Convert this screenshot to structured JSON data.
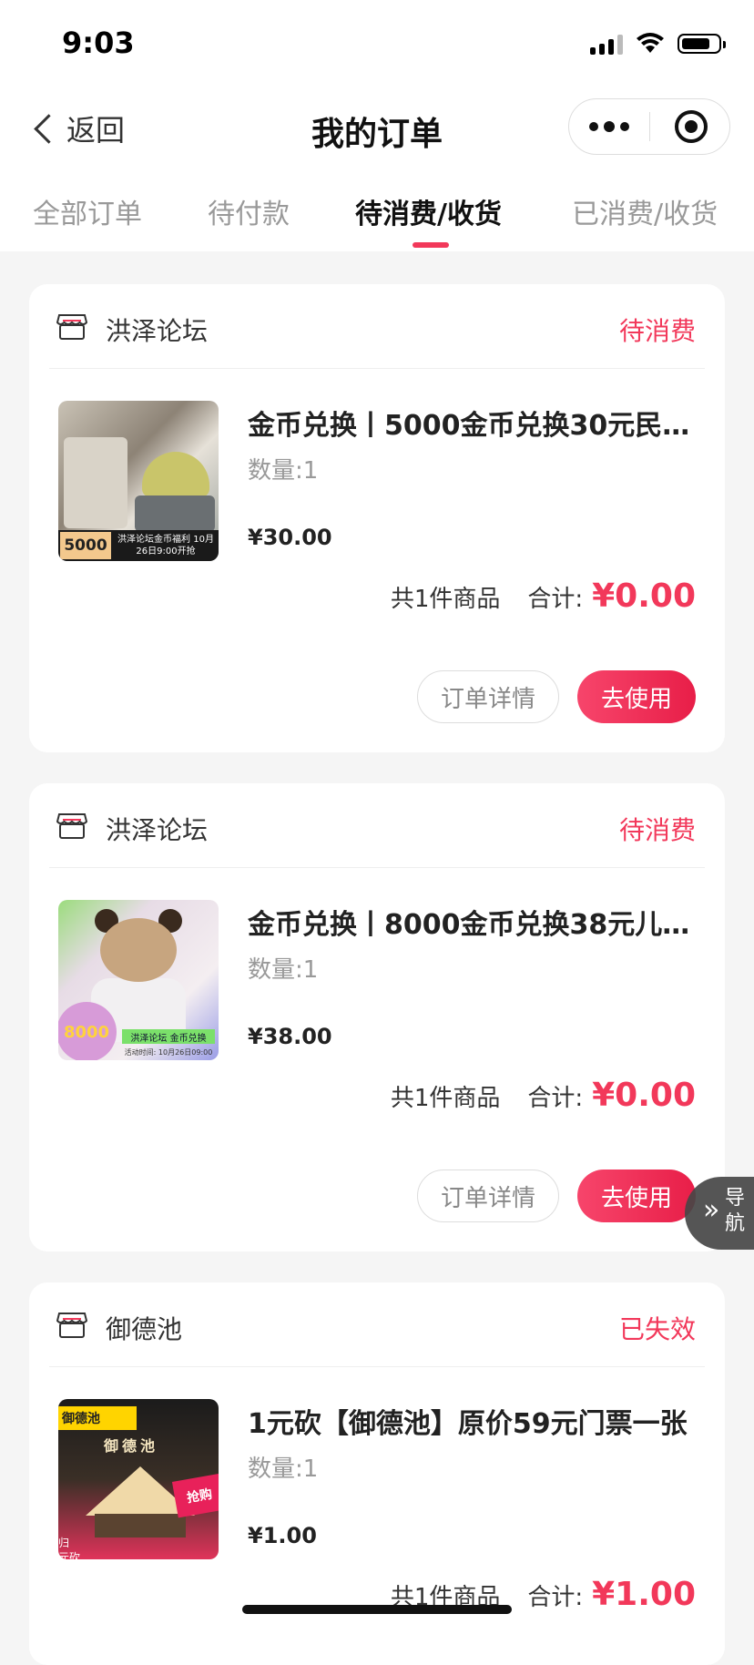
{
  "status_bar": {
    "time": "9:03"
  },
  "nav": {
    "back_label": "返回",
    "title": "我的订单"
  },
  "tabs": [
    {
      "label": "全部订单",
      "active": false
    },
    {
      "label": "待付款",
      "active": false
    },
    {
      "label": "待消费/收货",
      "active": true
    },
    {
      "label": "已消费/收货",
      "active": false
    }
  ],
  "orders": [
    {
      "shop": "洪泽论坛",
      "status": "待消费",
      "title": "金币兑换丨5000金币兑换30元民…",
      "quantity": "数量:1",
      "price": "¥30.00",
      "count": "共1件商品",
      "total_label": "合计:",
      "total_value": "¥0.00",
      "detail_label": "订单详情",
      "action_label": "去使用",
      "thumb": {
        "badge": "5000",
        "caption": "洪泽论坛金币福利 10月26日9:00开抢"
      }
    },
    {
      "shop": "洪泽论坛",
      "status": "待消费",
      "title": "金币兑换丨8000金币兑换38元儿…",
      "quantity": "数量:1",
      "price": "¥38.00",
      "count": "共1件商品",
      "total_label": "合计:",
      "total_value": "¥0.00",
      "detail_label": "订单详情",
      "action_label": "去使用",
      "thumb": {
        "badge": "8000",
        "caption": "洪泽论坛 金币兑换",
        "caption2": "活动时间: 10月26日09:00"
      }
    },
    {
      "shop": "御德池",
      "status": "已失效",
      "title": "1元砍【御德池】原价59元门票一张",
      "quantity": "数量:1",
      "price": "¥1.00",
      "count": "共1件商品",
      "total_label": "合计:",
      "total_value": "¥1.00",
      "thumb": {
        "tag": "御德池",
        "sign": "御德池",
        "side": "归 元砍",
        "burst": "抢购"
      }
    }
  ],
  "float_nav": {
    "arrows": "»",
    "label": "导航"
  },
  "colors": {
    "accent": "#f2385a",
    "background": "#f5f5f5"
  }
}
